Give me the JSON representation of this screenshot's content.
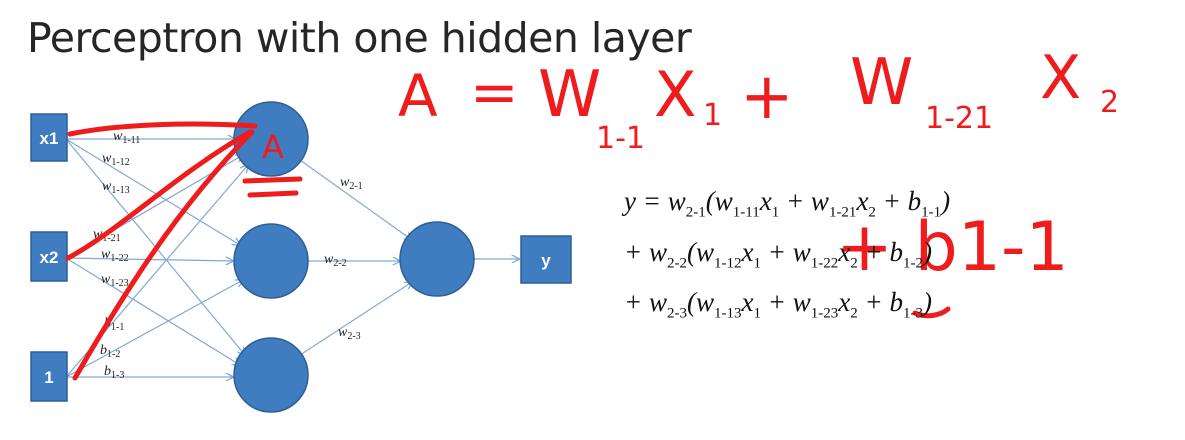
{
  "title": "Perceptron with one hidden layer",
  "colors": {
    "node_fill": "#3f7cc0",
    "node_stroke": "#2d5f97",
    "edge": "#7fa9d6",
    "ink": "#ee1c1c"
  },
  "inputs": [
    "x1",
    "x2",
    "1"
  ],
  "output": "y",
  "first_layer_weights": [
    {
      "b": "w",
      "s": "1-11"
    },
    {
      "b": "w",
      "s": "1-12"
    },
    {
      "b": "w",
      "s": "1-13"
    },
    {
      "b": "w",
      "s": "1-21"
    },
    {
      "b": "w",
      "s": "1-22"
    },
    {
      "b": "w",
      "s": "1-23"
    }
  ],
  "biases": [
    {
      "b": "b",
      "s": "1-1"
    },
    {
      "b": "b",
      "s": "1-2"
    },
    {
      "b": "b",
      "s": "1-3"
    }
  ],
  "second_layer_weights": [
    {
      "b": "w",
      "s": "2-1"
    },
    {
      "b": "w",
      "s": "2-2"
    },
    {
      "b": "w",
      "s": "2-3"
    }
  ],
  "equation": {
    "line1": {
      "lead": "y = ",
      "w2": "w",
      "w2s": "2-1",
      "wa": "w",
      "was": "1-11",
      "xa": "x",
      "xas": "1",
      "wb": "w",
      "wbs": "1-21",
      "xb": "x",
      "xbs": "2",
      "b": "b",
      "bs": "1-1"
    },
    "line2": {
      "lead": "+ ",
      "w2": "w",
      "w2s": "2-2",
      "wa": "w",
      "was": "1-12",
      "xa": "x",
      "xas": "1",
      "wb": "w",
      "wbs": "1-22",
      "xb": "x",
      "xbs": "2",
      "b": "b",
      "bs": "1-2"
    },
    "line3": {
      "lead": "+ ",
      "w2": "w",
      "w2s": "2-3",
      "wa": "w",
      "was": "1-13",
      "xa": "x",
      "xas": "1",
      "wb": "w",
      "wbs": "1-23",
      "xb": "x",
      "xbs": "2",
      "b": "b",
      "bs": "1-3"
    }
  },
  "annotations": {
    "note_lhs": "A",
    "note_eq": "=",
    "note_t1": "W",
    "note_t1s": "1-1",
    "note_t1x": "X",
    "note_t1xs": "1",
    "note_plus": "+",
    "note_t2": "W",
    "note_t2s": "1-21",
    "note_t2x": "X",
    "note_t2xs": "2",
    "note_bias": "+ b1-1",
    "node_label": "A"
  }
}
